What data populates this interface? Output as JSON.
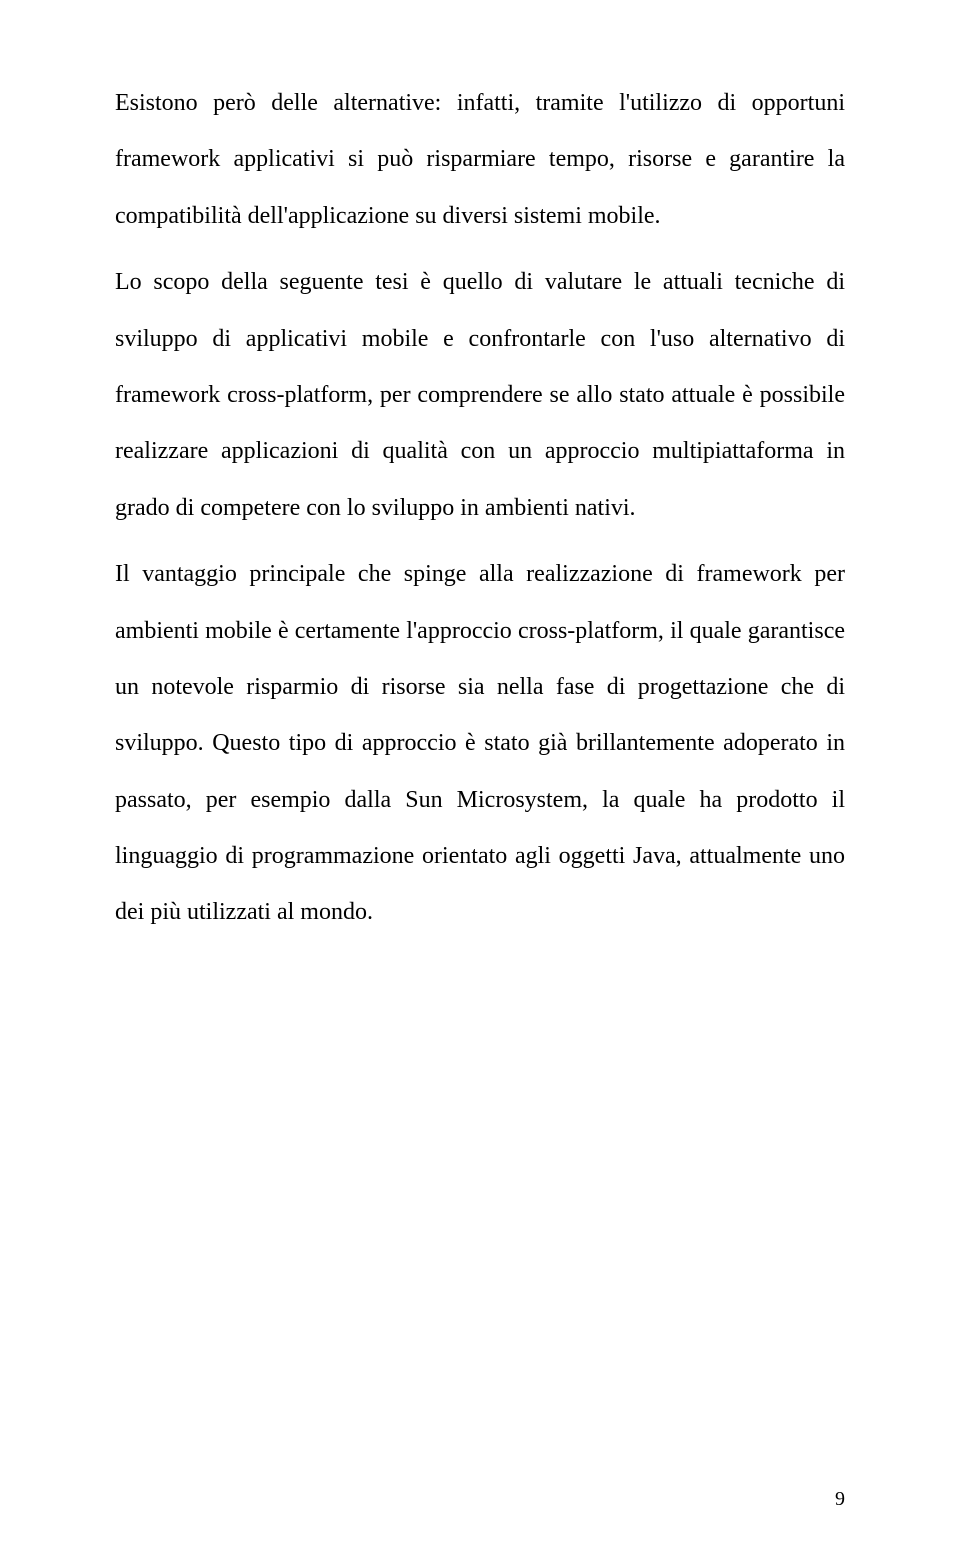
{
  "document": {
    "paragraphs": [
      "Esistono però delle alternative: infatti, tramite l'utilizzo di opportuni framework applicativi si può risparmiare tempo, risorse e garantire la compatibilità dell'applicazione su diversi sistemi mobile.",
      "Lo scopo della seguente tesi è quello di valutare le attuali tecniche di sviluppo di applicativi mobile e confrontarle con l'uso alternativo di framework cross-platform, per comprendere se allo stato attuale è possibile realizzare applicazioni di qualità con un approccio multipiattaforma in grado di competere con lo sviluppo in ambienti nativi.",
      "Il vantaggio principale che spinge alla realizzazione di framework per ambienti mobile è certamente l'approccio cross-platform, il quale garantisce un notevole risparmio di risorse sia nella fase di progettazione che di sviluppo. Questo tipo di approccio è stato già brillantemente adoperato in passato, per esempio dalla Sun Microsystem, la quale ha prodotto il linguaggio di programmazione orientato agli oggetti Java, attualmente uno dei più utilizzati al mondo."
    ],
    "page_number": "9"
  }
}
